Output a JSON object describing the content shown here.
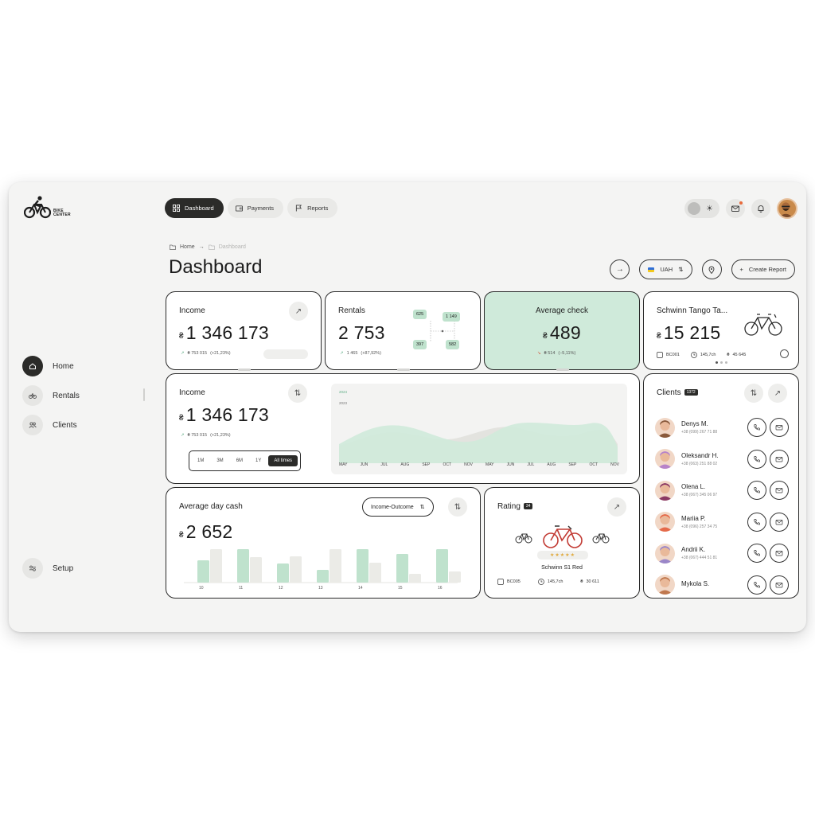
{
  "brand": {
    "line1": "BIKE",
    "line2": "CENTER"
  },
  "topnav": [
    {
      "label": "Dashboard",
      "active": true
    },
    {
      "label": "Payments",
      "active": false
    },
    {
      "label": "Reports",
      "active": false
    }
  ],
  "sidebar": {
    "items": [
      {
        "label": "Home",
        "icon": "home-icon",
        "active": true
      },
      {
        "label": "Rentals",
        "icon": "bike-icon",
        "active": false
      },
      {
        "label": "Clients",
        "icon": "users-icon",
        "active": false
      }
    ],
    "setup": "Setup"
  },
  "breadcrumb": {
    "home": "Home",
    "current": "Dashboard"
  },
  "page_title": "Dashboard",
  "actions": {
    "currency": "UAH",
    "create": "Create Report"
  },
  "colors": {
    "accent_green": "#cfeada",
    "bar_green": "#bfe2cd",
    "dark": "#2b2b29",
    "bar_grey": "#ebebe7"
  },
  "income_card": {
    "label": "Income",
    "currency": "₴",
    "value": "1 346 173",
    "sub": "₴ 753 015",
    "delta": "(+21,23%)"
  },
  "rentals_card": {
    "label": "Rentals",
    "value": "2 753",
    "sub": "1 465",
    "delta": "(+87,92%)",
    "tags": [
      "625",
      "1 149",
      "397",
      "582"
    ]
  },
  "avg_check_card": {
    "label": "Average check",
    "currency": "₴",
    "value": "489",
    "sub": "₴ 514",
    "delta": "(–5,11%)"
  },
  "bike_card": {
    "label": "Schwinn Tango Ta...",
    "currency": "₴",
    "value": "15 215",
    "code": "BC001",
    "hours": "145,7ch",
    "amount": "45 645"
  },
  "income_chart": {
    "label": "Income",
    "currency": "₴",
    "value": "1 346 173",
    "sub": "₴ 753 015",
    "delta": "(+21,23%)",
    "ranges": [
      "1M",
      "3M",
      "6M",
      "1Y",
      "All times"
    ],
    "active_range": "All times",
    "legend": [
      "2024",
      "2023"
    ],
    "months": [
      "MAY",
      "JUN",
      "JUL",
      "AUG",
      "SEP",
      "OCT",
      "NOV",
      "MAY",
      "JUN",
      "JUL",
      "AUG",
      "SEP",
      "OCT",
      "NOV"
    ]
  },
  "day_cash": {
    "label": "Average day cash",
    "currency": "₴",
    "value": "2 652",
    "filter": "Income-Outcome"
  },
  "chart_data": {
    "type": "bar",
    "categories": [
      "10",
      "11",
      "12",
      "13",
      "14",
      "15",
      "16"
    ],
    "series": [
      {
        "values": [
          28,
          42,
          24,
          16,
          42,
          36,
          42
        ]
      },
      {
        "values": [
          42,
          32,
          33,
          42,
          25,
          11,
          14
        ]
      }
    ],
    "ylim": [
      0,
      45
    ]
  },
  "rating_card": {
    "label": "Rating",
    "badge": "34",
    "bike_name": "Schwinn S1 Red",
    "stars": 5,
    "code": "BC005",
    "hours": "145,7ch",
    "amount": "30 611"
  },
  "clients": {
    "label": "Clients",
    "badge": "1372",
    "list": [
      {
        "name": "Denys M.",
        "phone": "+38 (099) 267 71 88",
        "color": "#8a5a3c"
      },
      {
        "name": "Oleksandr H.",
        "phone": "+38 (063) 251 88 02",
        "color": "#b784c9"
      },
      {
        "name": "Olena L.",
        "phone": "+38 (067) 345 06 97",
        "color": "#8b3a64"
      },
      {
        "name": "Mariia P.",
        "phone": "+38 (096) 257 34 75",
        "color": "#e56a4a"
      },
      {
        "name": "Andrii K.",
        "phone": "+38 (067) 444 51 81",
        "color": "#9a86c8"
      },
      {
        "name": "Mykola S.",
        "phone": "",
        "color": "#c0784e"
      }
    ]
  }
}
